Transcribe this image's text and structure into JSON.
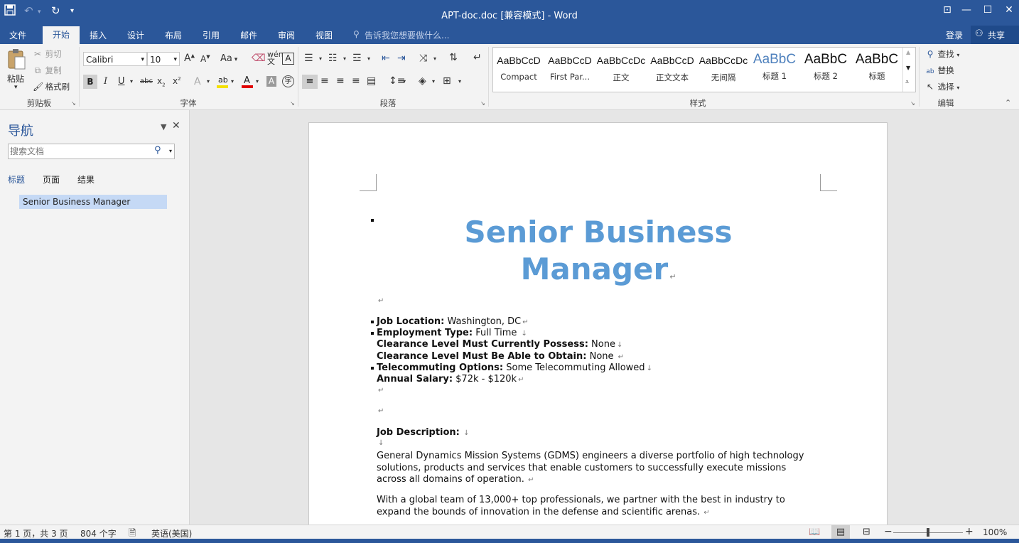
{
  "window": {
    "title": "APT-doc.doc [兼容模式] - Word",
    "quick_access": {
      "save_icon": "save-icon",
      "undo_icon": "undo-icon",
      "redo_icon": "redo-icon",
      "customize_icon": "customize-icon"
    },
    "controls": {
      "restore_ribbon": "ribbon-display-icon",
      "minimize": "minimize-icon",
      "maximize": "maximize-icon",
      "close": "close-icon"
    }
  },
  "tabs": [
    "文件",
    "开始",
    "插入",
    "设计",
    "布局",
    "引用",
    "邮件",
    "审阅",
    "视图"
  ],
  "tell_me": "告诉我您想要做什么...",
  "account": {
    "login": "登录",
    "share": "共享"
  },
  "ribbon": {
    "clipboard": {
      "paste": "粘贴",
      "cut": "剪切",
      "copy": "复制",
      "format_painter": "格式刷",
      "label": "剪贴板"
    },
    "font": {
      "name": "Calibri",
      "size": "10",
      "label": "字体",
      "case_btn": "Aa"
    },
    "paragraph": {
      "label": "段落"
    },
    "styles": {
      "label": "样式",
      "items": [
        {
          "sample": "AaBbCcD",
          "name": "Compact",
          "color": "#111111"
        },
        {
          "sample": "AaBbCcD",
          "name": "First Par...",
          "color": "#111111"
        },
        {
          "sample": "AaBbCcDc",
          "name": "正文",
          "color": "#111111"
        },
        {
          "sample": "AaBbCcD",
          "name": "正文文本",
          "color": "#111111"
        },
        {
          "sample": "AaBbCcDc",
          "name": "无间隔",
          "color": "#111111"
        },
        {
          "sample": "AaBbC",
          "name": "标题 1",
          "color": "#4f81bd"
        },
        {
          "sample": "AaBbC",
          "name": "标题 2",
          "color": "#111111"
        },
        {
          "sample": "AaBbC",
          "name": "标题",
          "color": "#111111"
        }
      ]
    },
    "editing": {
      "find": "查找",
      "replace": "替换",
      "select": "选择",
      "label": "编辑"
    }
  },
  "navigation": {
    "title": "导航",
    "search_placeholder": "搜索文档",
    "tabs": [
      "标题",
      "页面",
      "结果"
    ],
    "headings": [
      "Senior Business Manager"
    ]
  },
  "document": {
    "title_line1": "Senior Business",
    "title_line2": "Manager",
    "fields": [
      {
        "label": "Job Location:",
        "value": " Washington, DC"
      },
      {
        "label": "Employment Type:",
        "value": " Full Time "
      },
      {
        "label": "Clearance Level Must Currently Possess:",
        "value": " None"
      },
      {
        "label": "Clearance Level Must Be Able to Obtain:",
        "value": " None "
      },
      {
        "label": "Telecommuting Options:",
        "value": " Some Telecommuting Allowed"
      },
      {
        "label": "Annual Salary:",
        "value": " $72k - $120k"
      }
    ],
    "job_desc_label": "Job Description:",
    "para1": [
      "General Dynamics Mission Systems (GDMS) engineers a diverse portfolio of high technology",
      "solutions, products and services that enable customers to successfully execute missions",
      "across all domains of operation."
    ],
    "para2": [
      "With a global team of 13,000+ top professionals, we partner with the best in industry to",
      "expand the bounds of innovation in the defense and scientific arenas."
    ]
  },
  "status": {
    "page": "第 1 页，共 3 页",
    "words": "804 个字",
    "language": "英语(美国)",
    "zoom": "100%"
  },
  "colors": {
    "brand": "#2b579a",
    "heading": "#5b9bd5",
    "nav_selected": "#c5d9f5"
  }
}
